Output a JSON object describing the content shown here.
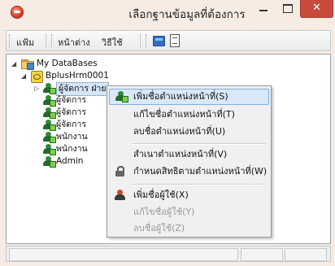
{
  "window": {
    "title": "เลือกฐานข้อมูลที่ต้องการ",
    "close_glyph": "✕"
  },
  "toolbar": {
    "items": [
      "แฟ้ม",
      "หน้าต่าง",
      "วิธีใช้"
    ],
    "icons": [
      "database-icon",
      "page-icon"
    ]
  },
  "tree": {
    "root": "My DataBases",
    "server": "BplusHrm0001",
    "items": [
      "ผู้จัดการ",
      "ผู้จัดการ",
      "ผู้จัดการ",
      "ผู้จัดการ",
      "พนักงาน",
      "พนักงาน",
      "Admin"
    ],
    "selected_partial": "ผู้จัดการ ฝ่าย",
    "expanded_glyph": "◢",
    "collapsed_glyph": "▷"
  },
  "context_menu": {
    "items": [
      {
        "label": "เพิ่มชื่อตำแหน่งหน้าที่(S)",
        "icon": "user-add-icon",
        "enabled": true,
        "highlighted": true
      },
      {
        "label": "แก้ไขชื่อตำแหน่งหน้าที่(T)",
        "icon": "",
        "enabled": true
      },
      {
        "label": "ลบชื่อตำแหน่งหน้าที่(U)",
        "icon": "",
        "enabled": true
      },
      {
        "label": "สำเนาตำแหน่งหน้าที่(V)",
        "icon": "",
        "enabled": true
      },
      {
        "label": "กำหนดสิทธิตามตำแหน่งหน้าที่(W)",
        "icon": "lock-icon",
        "enabled": true
      },
      {
        "label": "เพิ่มชื่อผู้ใช้(X)",
        "icon": "person-icon",
        "enabled": true
      },
      {
        "label": "แก้ไขชื่อผู้ใช้(Y)",
        "icon": "",
        "enabled": false
      },
      {
        "label": "ลบชื่อผู้ใช้(Z)",
        "icon": "",
        "enabled": false
      }
    ]
  },
  "colors": {
    "window_bg": "#f6ece4",
    "close_button": "#c84a3d",
    "menu_highlight": "#d9e8f8",
    "disabled_text": "#9a9a9a"
  }
}
